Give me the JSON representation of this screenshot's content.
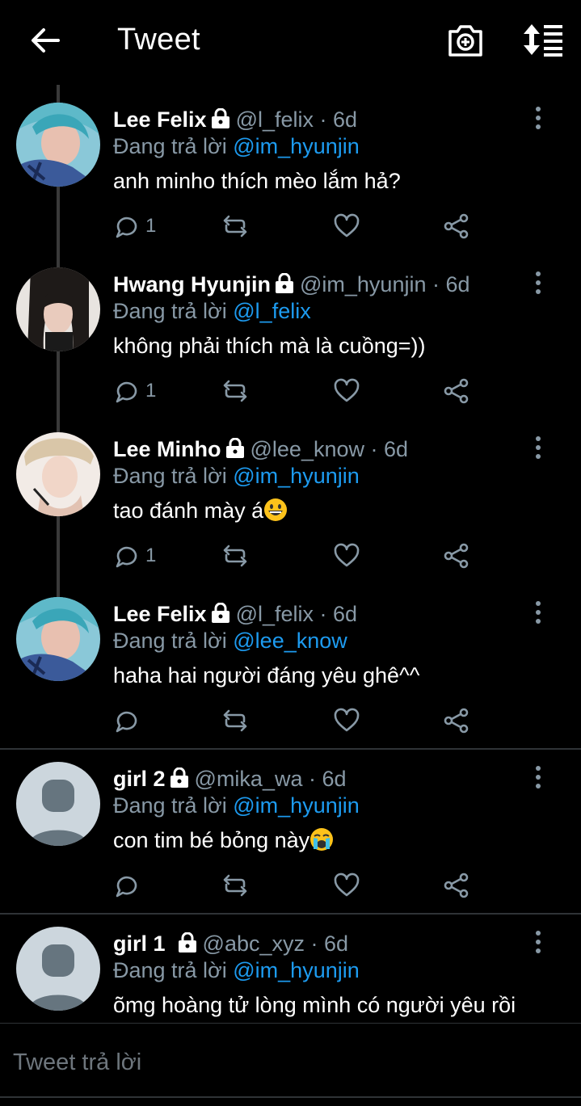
{
  "header": {
    "title": "Tweet"
  },
  "tweets": [
    {
      "name": "Lee Felix",
      "handle": "@l_felix",
      "sep": " · ",
      "time": "6d",
      "reply_prefix": "Đang trả lời ",
      "reply_to": "@im_hyunjin",
      "text": "anh minho thích mèo lắm hả?",
      "reply_count": "1"
    },
    {
      "name": "Hwang Hyunjin",
      "handle": "@im_hyunjin",
      "sep": " · ",
      "time": "6d",
      "reply_prefix": "Đang trả lời ",
      "reply_to": "@l_felix",
      "text": "không phải thích mà là cuồng=))",
      "reply_count": "1"
    },
    {
      "name": "Lee Minho",
      "handle": "@lee_know",
      "sep": " · ",
      "time": "6d",
      "reply_prefix": "Đang trả lời ",
      "reply_to": "@im_hyunjin",
      "text": "tao đánh mày á",
      "reply_count": "1"
    },
    {
      "name": "Lee Felix",
      "handle": "@l_felix",
      "sep": " · ",
      "time": "6d",
      "reply_prefix": "Đang trả lời ",
      "reply_to": "@lee_know",
      "text": "haha hai người đáng yêu ghê^^",
      "reply_count": ""
    },
    {
      "name": "girl 2",
      "handle": "@mika_wa",
      "sep": " · ",
      "time": "6d",
      "reply_prefix": "Đang trả lời ",
      "reply_to": "@im_hyunjin",
      "text": "con tim bé bỏng này",
      "reply_count": ""
    },
    {
      "name": "girl 1",
      "handle": "@abc_xyz",
      "sep": " · ",
      "time": "6d",
      "reply_prefix": "Đang trả lời ",
      "reply_to": "@im_hyunjin",
      "text": "õmg hoàng tử lòng mình có người yêu rồi",
      "reply_count": ""
    }
  ],
  "compose": {
    "placeholder": "Tweet trả lời"
  },
  "colors": {
    "accent": "#1d9bf0",
    "muted": "#8899a6",
    "background": "#000000"
  }
}
